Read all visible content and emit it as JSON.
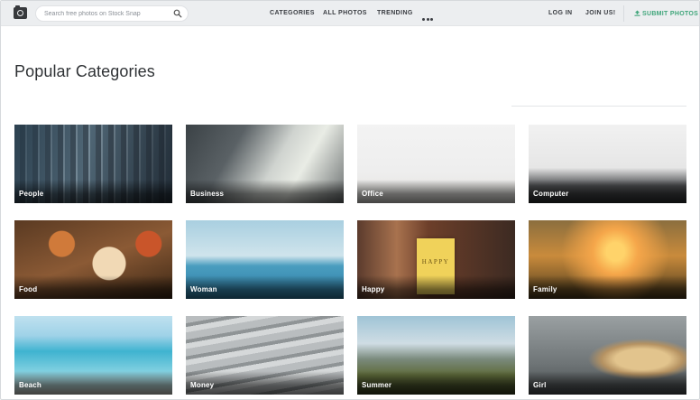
{
  "header": {
    "logo": "camera-logo-icon",
    "search": {
      "placeholder": "Search free photos on Stock Snap",
      "value": "",
      "icon": "search-icon"
    },
    "nav": [
      {
        "label": "CATEGORIES"
      },
      {
        "label": "ALL PHOTOS"
      },
      {
        "label": "TRENDING"
      }
    ],
    "more_icon": "more-dots-icon",
    "login_label": "LOG IN",
    "join_label": "JOIN US!",
    "submit_label": "SUBMIT PHOTOS",
    "submit_icon": "upload-icon",
    "accent_color": "#3fa57a"
  },
  "main": {
    "title": "Popular Categories",
    "categories": [
      {
        "label": "People"
      },
      {
        "label": "Business"
      },
      {
        "label": "Office"
      },
      {
        "label": "Computer"
      },
      {
        "label": "Food"
      },
      {
        "label": "Woman"
      },
      {
        "label": "Happy"
      },
      {
        "label": "Family"
      },
      {
        "label": "Beach"
      },
      {
        "label": "Money"
      },
      {
        "label": "Summer"
      },
      {
        "label": "Girl"
      }
    ],
    "happy_book_text": "HAPPY"
  }
}
